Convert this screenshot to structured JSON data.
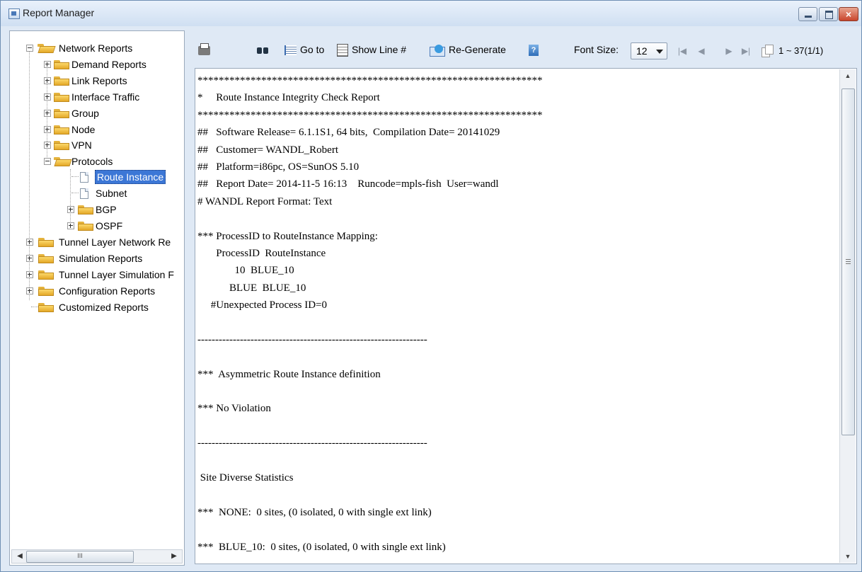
{
  "window": {
    "title": "Report Manager",
    "close_glyph": "×"
  },
  "tree": {
    "items": [
      {
        "label": "Network Reports",
        "icon": "folder-open-icon"
      },
      {
        "label": "Demand Reports",
        "icon": "folder-icon"
      },
      {
        "label": "Link Reports",
        "icon": "folder-icon"
      },
      {
        "label": "Interface Traffic",
        "icon": "folder-icon"
      },
      {
        "label": "Group",
        "icon": "folder-icon"
      },
      {
        "label": "Node",
        "icon": "folder-icon"
      },
      {
        "label": "VPN",
        "icon": "folder-icon"
      },
      {
        "label": "Protocols",
        "icon": "folder-open-icon"
      },
      {
        "label": "Route Instance",
        "icon": "document-icon",
        "selected": true
      },
      {
        "label": "Subnet",
        "icon": "document-icon"
      },
      {
        "label": "BGP",
        "icon": "folder-icon"
      },
      {
        "label": "OSPF",
        "icon": "folder-icon"
      },
      {
        "label": "Tunnel Layer Network Re",
        "icon": "folder-icon"
      },
      {
        "label": "Simulation Reports",
        "icon": "folder-icon"
      },
      {
        "label": "Tunnel Layer Simulation F",
        "icon": "folder-icon"
      },
      {
        "label": "Configuration Reports",
        "icon": "folder-icon"
      },
      {
        "label": "Customized Reports",
        "icon": "folder-icon"
      }
    ],
    "scroll_grip": "III",
    "scroll_left": "◀",
    "scroll_right": "▶"
  },
  "toolbar": {
    "goto_label": "Go to",
    "show_line_label": "Show Line #",
    "regenerate_label": "Re-Generate",
    "help_glyph": "?",
    "font_size_label": "Font Size:",
    "font_size_value": "12",
    "nav_first": "|◀",
    "nav_prev": "◀",
    "nav_next": "▶",
    "nav_last": "▶|",
    "page_info": "1 ~ 37(1/1)"
  },
  "report": {
    "lines": [
      "*****************************************************************",
      "*     Route Instance Integrity Check Report",
      "*****************************************************************",
      "##   Software Release= 6.1.1S1, 64 bits,  Compilation Date= 20141029",
      "##   Customer= WANDL_Robert",
      "##   Platform=i86pc, OS=SunOS 5.10",
      "##   Report Date= 2014-11-5 16:13    Runcode=mpls-fish  User=wandl",
      "# WANDL Report Format: Text",
      "",
      "*** ProcessID to RouteInstance Mapping:",
      "       ProcessID  RouteInstance",
      "              10  BLUE_10",
      "            BLUE  BLUE_10",
      "     #Unexpected Process ID=0",
      "",
      "-----------------------------------------------------------------",
      "",
      "***  Asymmetric Route Instance definition",
      "",
      "*** No Violation",
      "",
      "-----------------------------------------------------------------",
      "",
      " Site Diverse Statistics",
      "",
      "***  NONE:  0 sites, (0 isolated, 0 with single ext link)",
      "",
      "***  BLUE_10:  0 sites, (0 isolated, 0 with single ext link)"
    ],
    "scroll_up": "▲",
    "scroll_down": "▼"
  }
}
